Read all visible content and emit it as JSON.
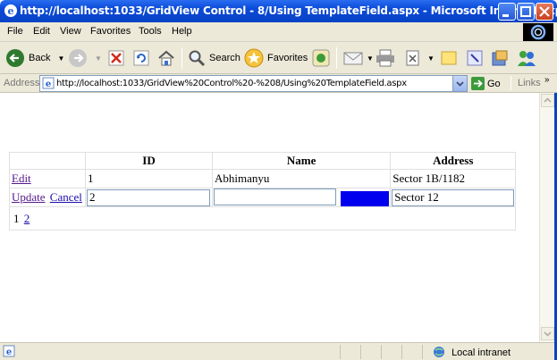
{
  "window": {
    "title": "http://localhost:1033/GridView Control - 8/Using TemplateField.aspx - Microsoft Internet Expl..."
  },
  "menu": [
    "File",
    "Edit",
    "View",
    "Favorites",
    "Tools",
    "Help"
  ],
  "toolbar": {
    "back_label": "Back",
    "search_label": "Search",
    "favorites_label": "Favorites"
  },
  "address": {
    "label": "Address",
    "url": "http://localhost:1033/GridView%20Control%20-%208/Using%20TemplateField.aspx",
    "go_label": "Go",
    "links_label": "Links"
  },
  "grid": {
    "headers": [
      "",
      "ID",
      "Name",
      "Address"
    ],
    "row1": {
      "edit": "Edit",
      "id": "1",
      "name": "Abhimanyu",
      "address": "Sector 1B/1182"
    },
    "row2": {
      "update": "Update",
      "cancel": "Cancel",
      "id": "2",
      "name": "",
      "address": "Sector 12"
    },
    "pager": {
      "current": "1",
      "next": "2"
    }
  },
  "status": {
    "zone": "Local intranet"
  },
  "colors": {
    "titlebar": "#0a4ad8",
    "chrome": "#ece9d8",
    "link": "#1a0dab",
    "button_blue": "#0000ee"
  }
}
